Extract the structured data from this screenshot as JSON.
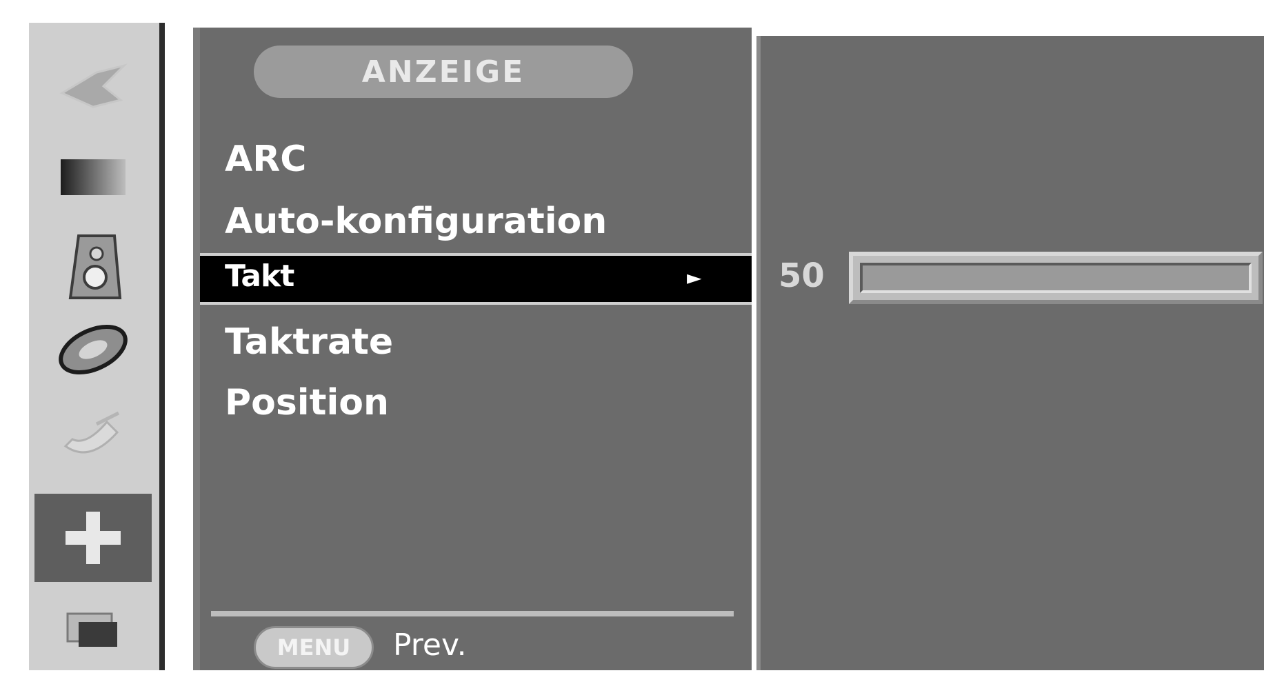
{
  "sidebar": {
    "items": [
      {
        "icon": "picture-icon",
        "active": false
      },
      {
        "icon": "screen-icon",
        "active": false
      },
      {
        "icon": "sound-icon",
        "active": false
      },
      {
        "icon": "disc-icon",
        "active": false
      },
      {
        "icon": "satellite-icon",
        "active": false
      },
      {
        "icon": "display-plus-icon",
        "active": true
      },
      {
        "icon": "pip-icon",
        "active": false
      }
    ]
  },
  "menu": {
    "title": "ANZEIGE",
    "items": [
      {
        "label": "ARC"
      },
      {
        "label": "Auto-konfiguration"
      },
      {
        "label": "Takt",
        "selected": true
      },
      {
        "label": "Taktrate"
      },
      {
        "label": "Position"
      }
    ],
    "selected_arrow": "►",
    "footer": {
      "menu_button": "MENU",
      "prev_label": "Prev."
    }
  },
  "value_panel": {
    "value": "50",
    "slider_level": 0.0
  },
  "colors": {
    "panel": "#6b6b6b",
    "sidebar": "#cfcfcf",
    "selected": "#000000",
    "text": "#ffffff"
  }
}
